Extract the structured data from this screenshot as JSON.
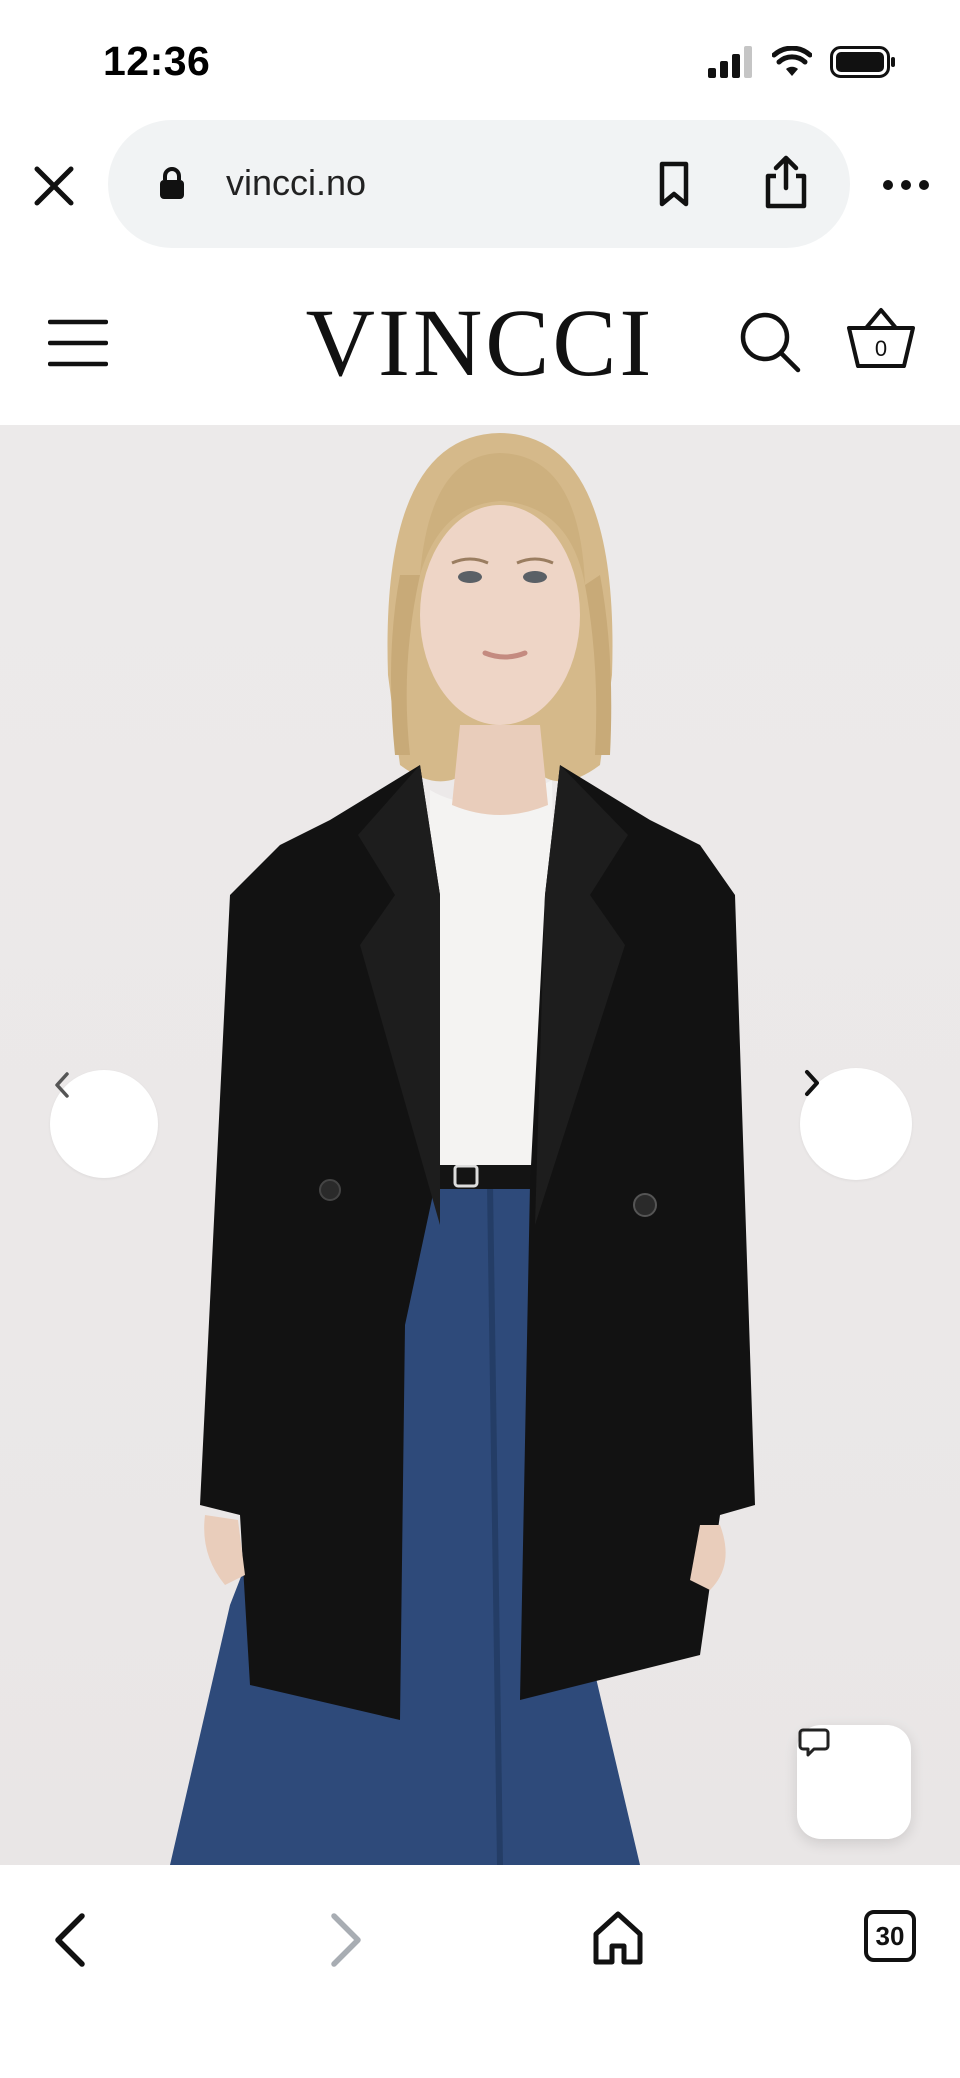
{
  "status_bar": {
    "time": "12:36",
    "icons": [
      "signal-icon",
      "wifi-icon",
      "battery-icon"
    ]
  },
  "browser": {
    "url": "vincci.no",
    "icons": [
      "close-icon",
      "lock-icon",
      "bookmark-icon",
      "share-icon",
      "more-icon"
    ]
  },
  "site_header": {
    "logo": "VINCCI",
    "cart_count": "0",
    "icons": [
      "hamburger-menu-icon",
      "search-icon",
      "basket-icon"
    ]
  },
  "hero": {
    "icons": [
      "chevron-left-icon",
      "chevron-right-icon",
      "chat-bubble-icon"
    ]
  },
  "bottom_bar": {
    "tab_count": "30",
    "icons": [
      "back-icon",
      "forward-icon",
      "home-icon",
      "tabs-icon"
    ]
  },
  "colors": {
    "pill_bg": "#f1f3f4",
    "hero_bg": "#ebe8e8",
    "text": "#111111",
    "disabled": "#a8adb3"
  }
}
